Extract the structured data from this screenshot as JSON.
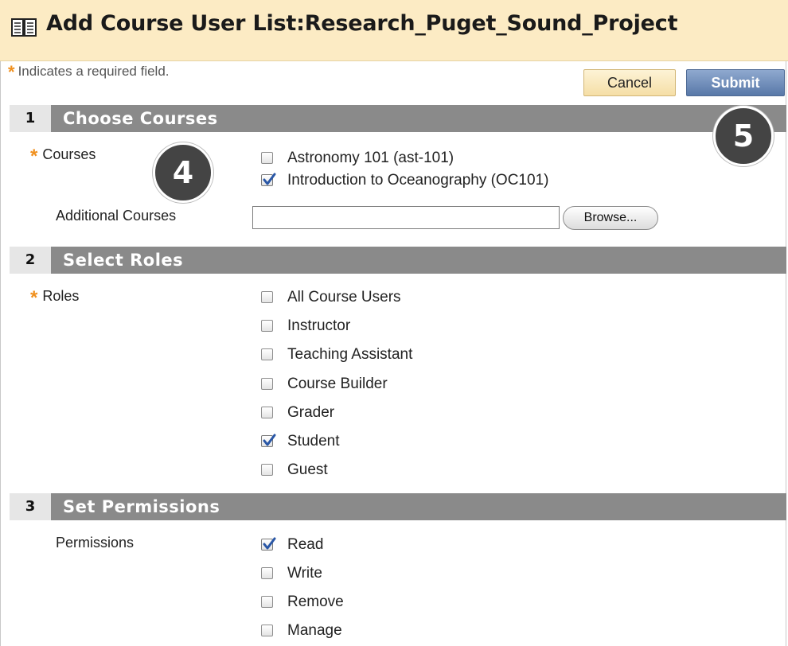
{
  "header": {
    "title": "Add Course User List:Research_Puget_Sound_Project",
    "icon": "open-book-icon"
  },
  "required_note": {
    "star": "*",
    "text": "Indicates a required field."
  },
  "buttons": {
    "cancel": "Cancel",
    "submit": "Submit"
  },
  "sections": [
    {
      "number": "1",
      "title": "Choose Courses"
    },
    {
      "number": "2",
      "title": "Select Roles"
    },
    {
      "number": "3",
      "title": "Set Permissions"
    }
  ],
  "courses": {
    "label": "Courses",
    "options": [
      {
        "label": "Astronomy 101 (ast-101)",
        "checked": false
      },
      {
        "label": "Introduction to Oceanography  (OC101)",
        "checked": true
      }
    ],
    "additional_label": "Additional Courses",
    "additional_value": "",
    "browse_label": "Browse..."
  },
  "roles": {
    "label": "Roles",
    "options": [
      {
        "label": "All Course Users",
        "checked": false
      },
      {
        "label": "Instructor",
        "checked": false
      },
      {
        "label": "Teaching Assistant",
        "checked": false
      },
      {
        "label": "Course Builder",
        "checked": false
      },
      {
        "label": "Grader",
        "checked": false
      },
      {
        "label": "Student",
        "checked": true
      },
      {
        "label": "Guest",
        "checked": false
      }
    ]
  },
  "permissions": {
    "label": "Permissions",
    "options": [
      {
        "label": "Read",
        "checked": true
      },
      {
        "label": "Write",
        "checked": false
      },
      {
        "label": "Remove",
        "checked": false
      },
      {
        "label": "Manage",
        "checked": false
      }
    ]
  },
  "badges": {
    "step4": "4",
    "step5": "5"
  },
  "colors": {
    "header_bg": "#fcebc4",
    "section_bar": "#8a8a8a",
    "required_star": "#f0901e",
    "submit_bg": "#5878a8"
  }
}
